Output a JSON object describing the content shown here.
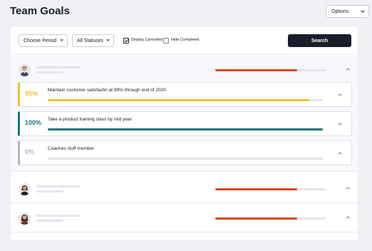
{
  "header": {
    "title": "Team Goals",
    "options_label": "Options"
  },
  "filters": {
    "period": "Choose Period",
    "status": "All Statuses",
    "display_cancelled": {
      "label": "Display Cancelled",
      "checked": true
    },
    "hide_completed": {
      "label": "Hide Completed",
      "checked": false
    },
    "search_label": "Search"
  },
  "colors": {
    "accent": "#1a1e2c",
    "progress_red": "#d9481f",
    "goal_yellow": "#f2c12e",
    "goal_teal": "#117a7f",
    "goal_gray": "#b5b8c1"
  },
  "members": [
    {
      "avatar": "avatar-man",
      "progress": 0.74,
      "expanded": true,
      "goals": [
        {
          "percent_label": "95%",
          "progress": 0.95,
          "title": "Maintain customer satisfactin at 99% through end of 2020",
          "color": "#f2c12e"
        },
        {
          "percent_label": "100%",
          "progress": 1.0,
          "title": "Take a product training class by mid year",
          "color": "#117a7f"
        },
        {
          "percent_label": "0%",
          "progress": 0.0,
          "title": "Coaches stuff member",
          "color": "#b5b8c1"
        }
      ]
    },
    {
      "avatar": "avatar-woman",
      "progress": 0.74,
      "expanded": false
    },
    {
      "avatar": "avatar-woman-2",
      "progress": 0.74,
      "expanded": false
    }
  ]
}
